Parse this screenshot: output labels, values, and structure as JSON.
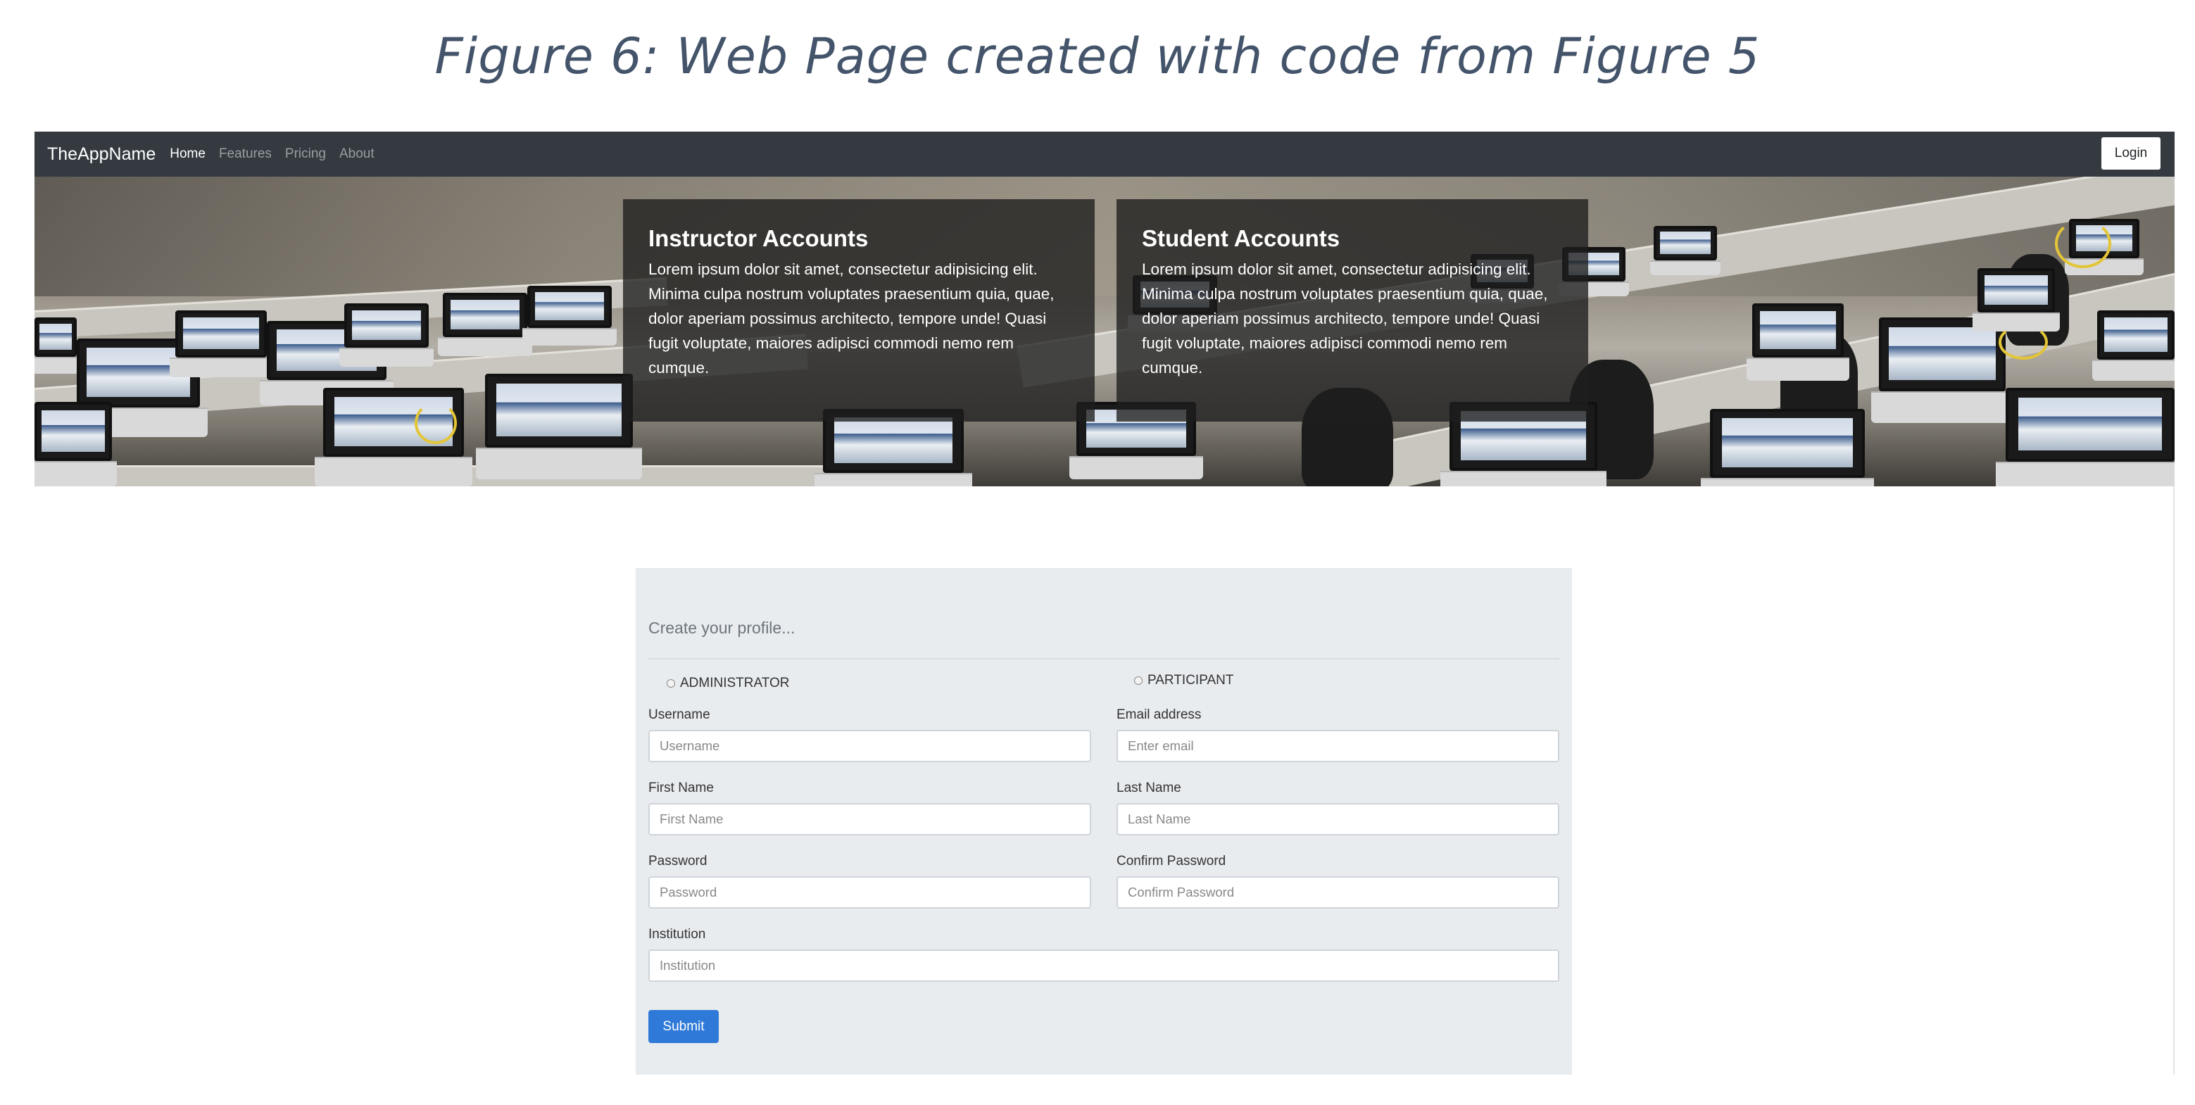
{
  "caption": "Figure 6: Web Page created with code from Figure 5",
  "navbar": {
    "brand": "TheAppName",
    "links": [
      "Home",
      "Features",
      "Pricing",
      "About"
    ],
    "active": "Home",
    "login_label": "Login",
    "bg_color": "#343a40"
  },
  "hero": {
    "cards": [
      {
        "title": "Instructor Accounts",
        "body": "Lorem ipsum dolor sit amet, consectetur adipisicing elit. Minima culpa nostrum voluptates praesentium quia, quae, dolor aperiam possimus architecto, tempore unde! Quasi fugit voluptate, maiores adipisci commodi nemo rem cumque."
      },
      {
        "title": "Student Accounts",
        "body": "Lorem ipsum dolor sit amet, consectetur adipisicing elit. Minima culpa nostrum voluptates praesentium quia, quae, dolor aperiam possimus architecto, tempore unde! Quasi fugit voluptate, maiores adipisci commodi nemo rem cumque."
      }
    ]
  },
  "form": {
    "lead": "Create your profile...",
    "roles": [
      "ADMINISTRATOR",
      "PARTICIPANT"
    ],
    "fields": {
      "username": {
        "label": "Username",
        "placeholder": "Username"
      },
      "email": {
        "label": "Email address",
        "placeholder": "Enter email"
      },
      "first_name": {
        "label": "First Name",
        "placeholder": "First Name"
      },
      "last_name": {
        "label": "Last Name",
        "placeholder": "Last Name"
      },
      "password": {
        "label": "Password",
        "placeholder": "Password"
      },
      "confirm_password": {
        "label": "Confirm Password",
        "placeholder": "Confirm Password"
      },
      "institution": {
        "label": "Institution",
        "placeholder": "Institution"
      }
    },
    "submit_label": "Submit",
    "submit_color": "#2f7ad8"
  }
}
